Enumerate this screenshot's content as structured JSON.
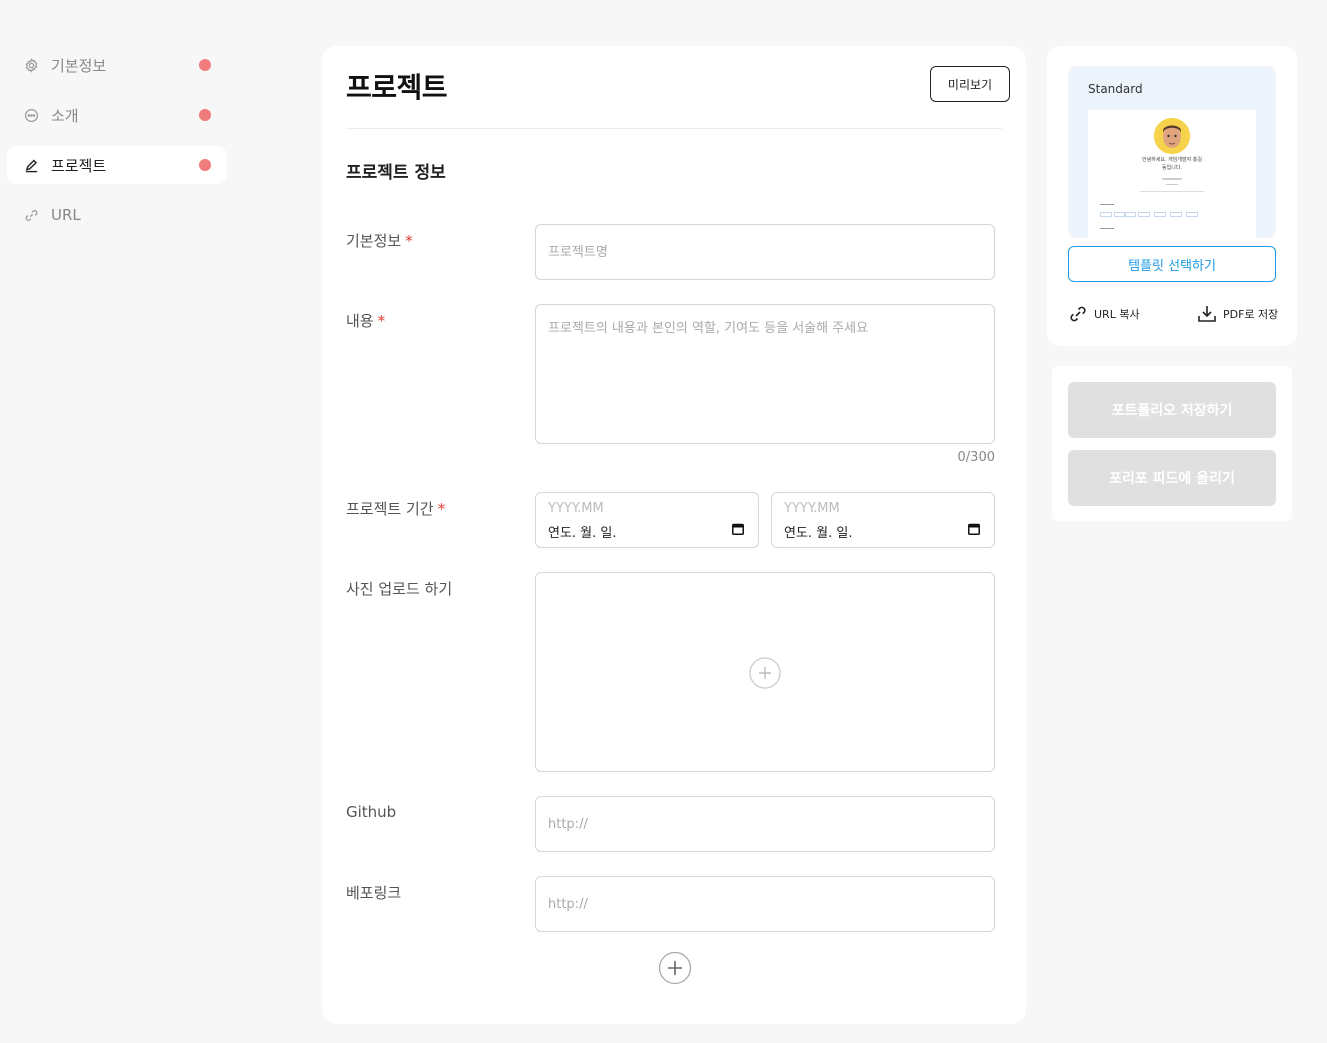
{
  "sidebar": {
    "items": [
      {
        "label": "기본정보",
        "icon": "gear-icon"
      },
      {
        "label": "소개",
        "icon": "chat-icon"
      },
      {
        "label": "프로젝트",
        "icon": "pencil-icon"
      },
      {
        "label": "URL",
        "icon": "link-icon"
      }
    ],
    "active_index": 2
  },
  "main": {
    "title": "프로젝트",
    "preview_label": "미리보기",
    "section_title": "프로젝트 정보",
    "fields": {
      "basic": {
        "label": "기본정보",
        "required_mark": "*",
        "placeholder": "프로젝트명",
        "value": ""
      },
      "content": {
        "label": "내용",
        "required_mark": "*",
        "placeholder": "프로젝트의 내용과 본인의 역할, 기여도 등을 서술해 주세요",
        "counter": "0/300"
      },
      "period": {
        "label": "프로젝트 기간",
        "required_mark": "*",
        "start": {
          "placeholder": "YYYY.MM",
          "value": "연도. 월. 일."
        },
        "end": {
          "placeholder": "YYYY.MM",
          "value": "연도. 월. 일."
        }
      },
      "photo": {
        "label": "사진 업로드 하기"
      },
      "github": {
        "label": "Github",
        "placeholder": "http://"
      },
      "deploy": {
        "label": "베포링크",
        "placeholder": "http://"
      }
    }
  },
  "right_panel": {
    "template_name": "Standard",
    "template_preview": {
      "greeting": "안녕하세요. 게임개발자 홍길동입니다."
    },
    "template_button": "템플릿 선택하기",
    "copy_url": "URL 복사",
    "save_pdf": "PDF로 저장",
    "save_portfolio": "포트폴리오 저장하기",
    "post_feed": "포리포 피드에 올리기"
  },
  "colors": {
    "accent": "#1e9be4",
    "required": "#e53935",
    "indicator_dot": "#f07c7c",
    "disabled_button": "#e0e0e0"
  }
}
